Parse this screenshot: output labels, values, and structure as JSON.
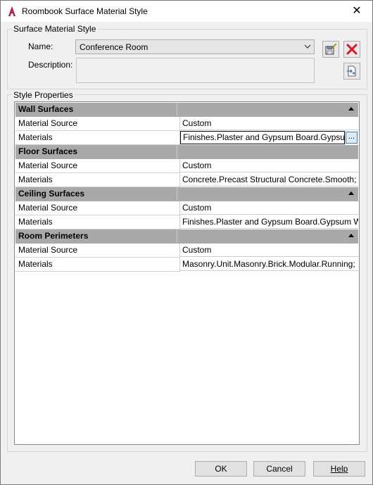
{
  "window": {
    "title": "Roombook Surface Material Style",
    "close_glyph": "✕"
  },
  "surface_group": {
    "label": "Surface Material Style",
    "name_label": "Name:",
    "name_value": "Conference Room",
    "description_label": "Description:",
    "description_value": ""
  },
  "properties_group": {
    "label": "Style Properties",
    "sections": [
      {
        "title": "Wall Surfaces",
        "rows": [
          {
            "key": "Material Source",
            "value": "Custom"
          },
          {
            "key": "Materials",
            "value": "Finishes.Plaster and Gypsum Board.Gypsum",
            "editing": true,
            "browse_label": "..."
          }
        ]
      },
      {
        "title": "Floor Surfaces",
        "rows": [
          {
            "key": "Material Source",
            "value": "Custom"
          },
          {
            "key": "Materials",
            "value": "Concrete.Precast Structural Concrete.Smooth; F"
          }
        ]
      },
      {
        "title": "Ceiling Surfaces",
        "rows": [
          {
            "key": "Material Source",
            "value": "Custom"
          },
          {
            "key": "Materials",
            "value": "Finishes.Plaster and Gypsum Board.Gypsum Wa"
          }
        ]
      },
      {
        "title": "Room Perimeters",
        "rows": [
          {
            "key": "Material Source",
            "value": "Custom"
          },
          {
            "key": "Materials",
            "value": "Masonry.Unit.Masonry.Brick.Modular.Running;"
          }
        ]
      }
    ]
  },
  "buttons": {
    "ok": "OK",
    "cancel": "Cancel",
    "help": "Help"
  },
  "colors": {
    "section_header_bg": "#a9a9a9",
    "delete_red": "#e81123",
    "window_bg": "#f0f0f0"
  }
}
